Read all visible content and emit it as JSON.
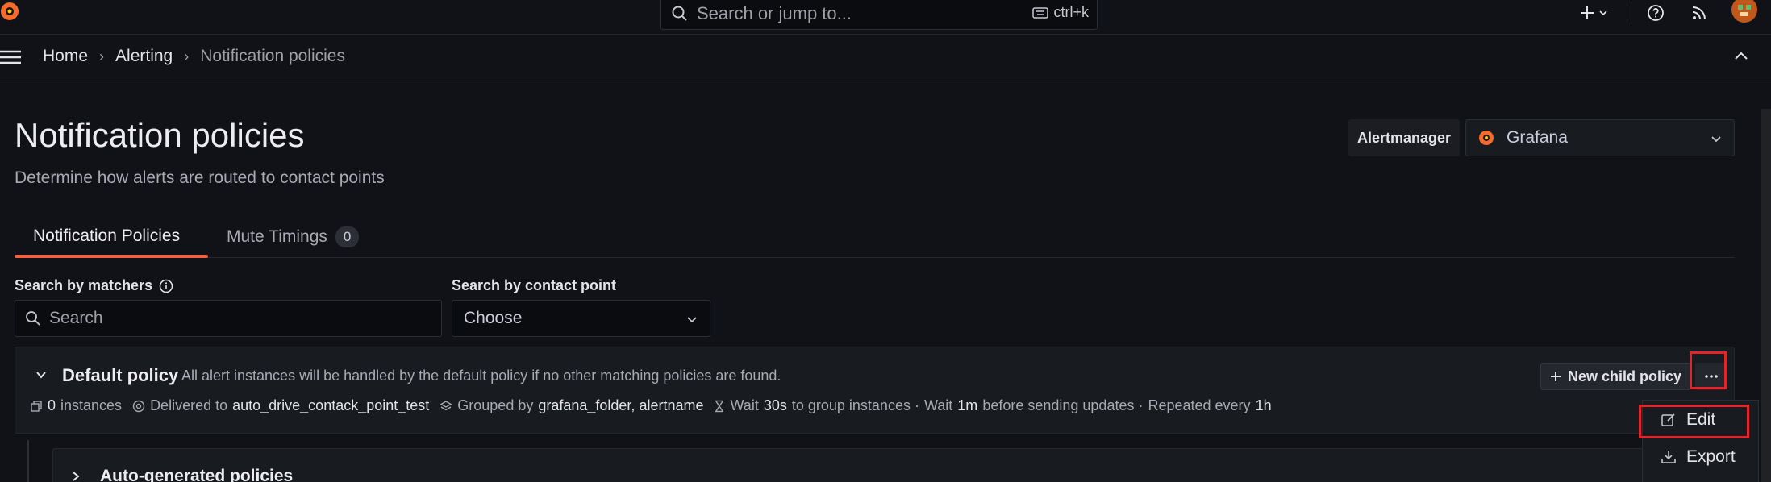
{
  "topbar": {
    "search_placeholder": "Search or jump to...",
    "shortcut": "ctrl+k"
  },
  "breadcrumb": [
    "Home",
    "Alerting",
    "Notification policies"
  ],
  "page": {
    "title": "Notification policies",
    "subtitle": "Determine how alerts are routed to contact points"
  },
  "alertmanager": {
    "label": "Alertmanager",
    "selected": "Grafana"
  },
  "tabs": [
    {
      "label": "Notification Policies"
    },
    {
      "label": "Mute Timings",
      "count": "0"
    }
  ],
  "filters": {
    "matchers_label": "Search by matchers",
    "matchers_placeholder": "Search",
    "contact_label": "Search by contact point",
    "contact_placeholder": "Choose"
  },
  "default_policy": {
    "title": "Default policy",
    "description": "All alert instances will be handled by the default policy if no other matching policies are found.",
    "new_child_label": "New child policy",
    "instances_count": "0",
    "instances_label": "instances",
    "delivered_label": "Delivered to",
    "contact_point": "auto_drive_contack_point_test",
    "grouped_label": "Grouped by",
    "grouped_value": "grafana_folder, alertname",
    "wait_label": "Wait",
    "group_wait": "30s",
    "group_wait_suffix": "to group instances ·",
    "group_interval_label": "Wait",
    "group_interval": "1m",
    "group_interval_suffix": "before sending updates ·",
    "repeat_label": "Repeated every",
    "repeat_interval": "1h"
  },
  "child_policy": {
    "title": "Auto-generated policies"
  },
  "menu": {
    "edit": "Edit",
    "export": "Export"
  },
  "colors": {
    "accent": "#f55f3e",
    "highlight": "#e3242b",
    "background": "#111217"
  }
}
